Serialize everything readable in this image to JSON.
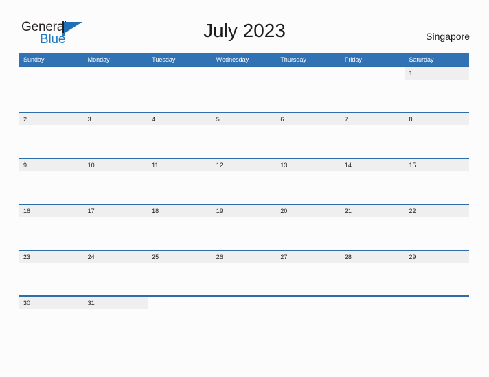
{
  "brand": {
    "word_one": "General",
    "word_two": "Blue",
    "flag_icon": "flag-triangle-icon"
  },
  "header": {
    "title": "July 2023",
    "location": "Singapore"
  },
  "calendar": {
    "day_headers": [
      "Sunday",
      "Monday",
      "Tuesday",
      "Wednesday",
      "Thursday",
      "Friday",
      "Saturday"
    ],
    "colors": {
      "header_blue": "#3072b4",
      "row_rule_blue": "#2e6da8",
      "day_band_gray": "#efefef",
      "page_background": "#fcfcfc",
      "brand_blue": "#1f7ac4",
      "text_dark": "#1c1c1c"
    },
    "weeks": [
      {
        "days": [
          "",
          "",
          "",
          "",
          "",
          "",
          "1"
        ]
      },
      {
        "days": [
          "2",
          "3",
          "4",
          "5",
          "6",
          "7",
          "8"
        ]
      },
      {
        "days": [
          "9",
          "10",
          "11",
          "12",
          "13",
          "14",
          "15"
        ]
      },
      {
        "days": [
          "16",
          "17",
          "18",
          "19",
          "20",
          "21",
          "22"
        ]
      },
      {
        "days": [
          "23",
          "24",
          "25",
          "26",
          "27",
          "28",
          "29"
        ]
      },
      {
        "days": [
          "30",
          "31",
          "",
          "",
          "",
          "",
          ""
        ]
      }
    ]
  }
}
